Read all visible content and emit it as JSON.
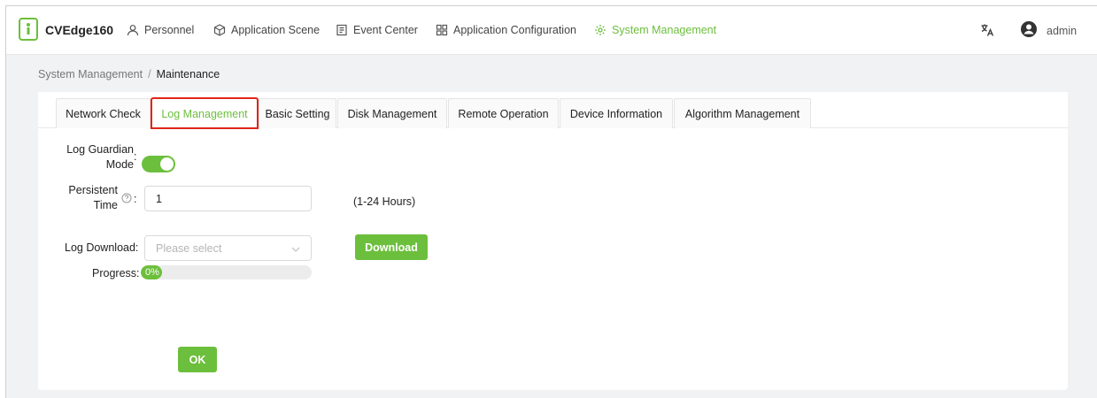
{
  "header": {
    "brand": "CVEdge160",
    "nav": [
      {
        "label": "Personnel",
        "icon": "person-icon",
        "active": false
      },
      {
        "label": "Application Scene",
        "icon": "cube-icon",
        "active": false
      },
      {
        "label": "Event Center",
        "icon": "document-icon",
        "active": false
      },
      {
        "label": "Application Configuration",
        "icon": "grid-icon",
        "active": false
      },
      {
        "label": "System Management",
        "icon": "gear-icon",
        "active": true
      }
    ],
    "user": "admin"
  },
  "breadcrumb": {
    "parent": "System Management",
    "separator": "/",
    "current": "Maintenance"
  },
  "tabs": [
    {
      "label": "Network Check",
      "active": false
    },
    {
      "label": "Log Management",
      "active": true
    },
    {
      "label": "Basic Setting",
      "active": false
    },
    {
      "label": "Disk Management",
      "active": false
    },
    {
      "label": "Remote Operation",
      "active": false
    },
    {
      "label": "Device Information",
      "active": false
    },
    {
      "label": "Algorithm Management",
      "active": false
    }
  ],
  "form": {
    "log_guardian_label_line1": "Log Guardian",
    "log_guardian_label_line2": "Mode",
    "log_guardian_enabled": true,
    "persistent_label_line1": "Persistent",
    "persistent_label_line2": "Time",
    "persistent_value": "1",
    "persistent_hint": "(1-24 Hours)",
    "log_download_label": "Log Download",
    "log_download_placeholder": "Please select",
    "download_button": "Download",
    "progress_label": "Progress",
    "progress_value": 0,
    "progress_text": "0%",
    "ok_button": "OK",
    "colon": ":"
  },
  "colors": {
    "accent": "#6cbf3c",
    "highlight_border": "#e0261b"
  }
}
